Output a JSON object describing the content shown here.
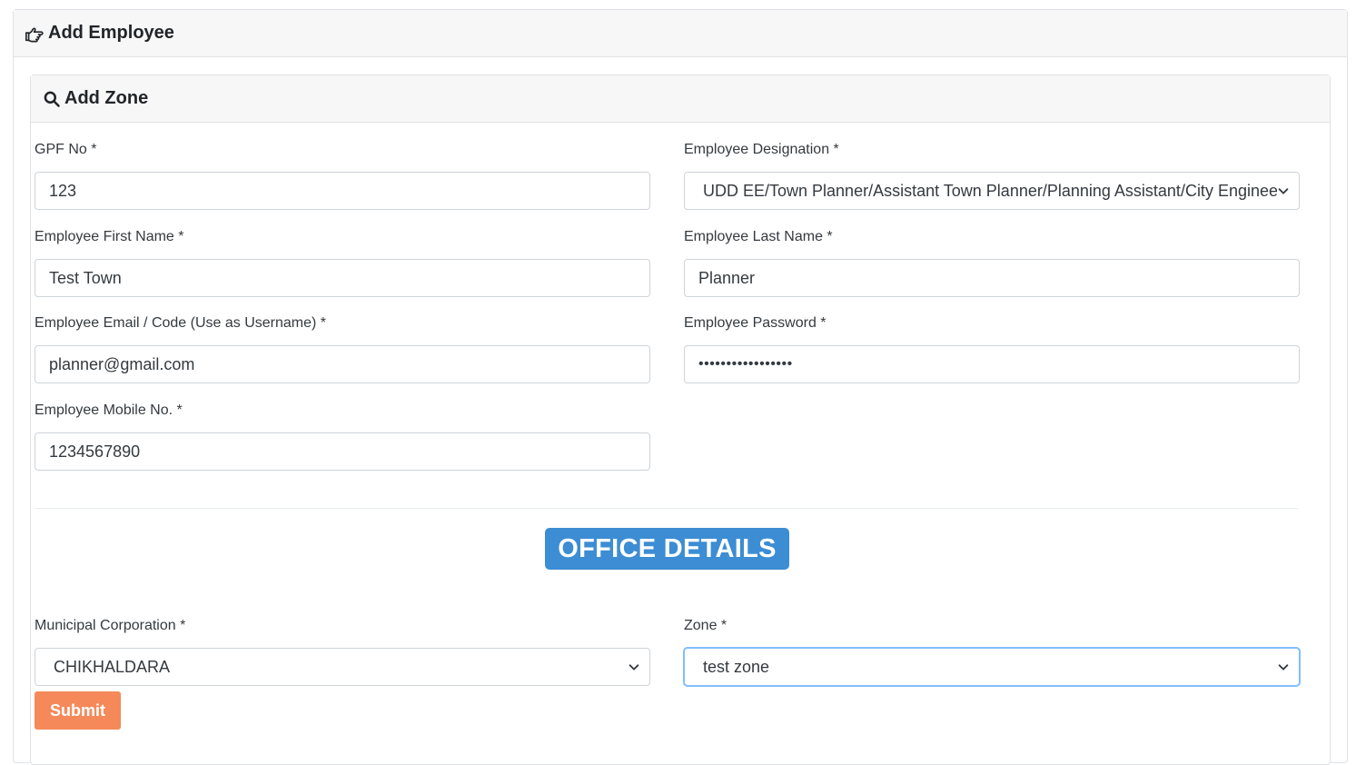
{
  "page": {
    "header_title": "Add Employee",
    "header_icon": "hand-pointer-icon"
  },
  "section": {
    "title": "Add Zone",
    "icon": "search-icon"
  },
  "form": {
    "gpf": {
      "label": "GPF No *",
      "value": "123"
    },
    "designation": {
      "label": "Employee Designation *",
      "value": "UDD EE/Town Planner/Assistant Town Planner/Planning Assistant/City Engineer"
    },
    "first_name": {
      "label": "Employee First Name *",
      "value": "Test Town"
    },
    "last_name": {
      "label": "Employee Last Name *",
      "value": "Planner"
    },
    "email": {
      "label": "Employee Email / Code (Use as Username) *",
      "value": "planner@gmail.com"
    },
    "password": {
      "label": "Employee Password *",
      "value": "•••••••••••••••••"
    },
    "mobile": {
      "label": "Employee Mobile No. *",
      "value": "1234567890"
    },
    "office_heading": "OFFICE DETAILS",
    "municipal_corporation": {
      "label": "Municipal Corporation *",
      "value": "CHIKHALDARA"
    },
    "zone": {
      "label": "Zone *",
      "value": "test zone"
    },
    "submit_label": "Submit"
  },
  "colors": {
    "badge": "#3c8dd3",
    "submit": "#f5895a",
    "focus_border": "#80bdff"
  }
}
